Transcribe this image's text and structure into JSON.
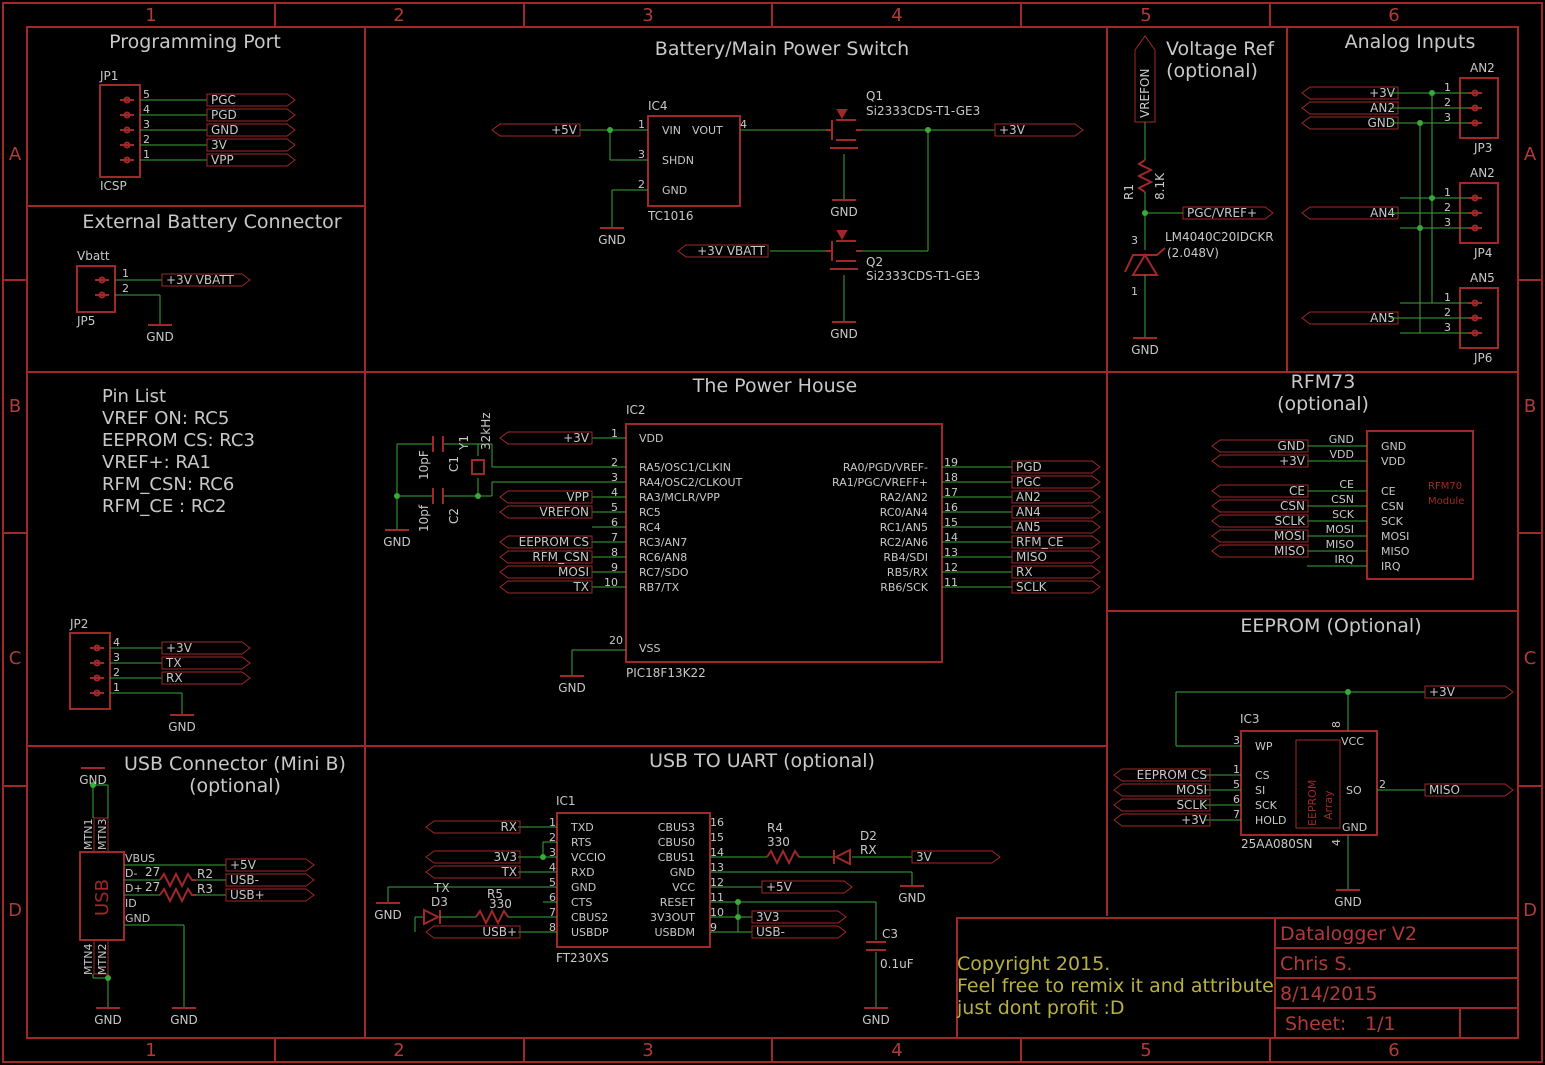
{
  "frame": {
    "columns": [
      "1",
      "2",
      "3",
      "4",
      "5",
      "6"
    ],
    "rows": [
      "A",
      "B",
      "C",
      "D"
    ]
  },
  "sections": {
    "programming_port": "Programming Port",
    "external_battery": "External Battery Connector",
    "battery_switch": "Battery/Main Power Switch",
    "voltage_ref_1": "Voltage Ref",
    "voltage_ref_2": "(optional)",
    "analog_inputs": "Analog Inputs",
    "power_house": "The Power House",
    "rfm73_1": "RFM73",
    "rfm73_2": "(optional)",
    "eeprom": "EEPROM (Optional)",
    "usb_conn_1": "USB Connector (Mini B)",
    "usb_conn_2": "(optional)",
    "usb_uart": "USB TO UART (optional)"
  },
  "pin_list": [
    "Pin List",
    "VREF ON: RC5",
    "EEPROM CS: RC3",
    "VREF+: RA1",
    "RFM_CSN: RC6",
    "RFM_CE : RC2"
  ],
  "jp1": {
    "name": "JP1",
    "value": "ICSP",
    "pins": [
      "5",
      "4",
      "3",
      "2",
      "1"
    ],
    "nets": [
      "PGC",
      "PGD",
      "GND",
      "3V",
      "VPP"
    ]
  },
  "jp5": {
    "name": "Vbatt",
    "ref": "JP5",
    "pins": [
      "1",
      "2"
    ],
    "net": "+3V VBATT",
    "gnd": "GND"
  },
  "jp2": {
    "name": "JP2",
    "pins": [
      "4",
      "3",
      "2",
      "1"
    ],
    "nets": [
      "+3V",
      "TX",
      "RX"
    ],
    "gnd": "GND"
  },
  "ic4": {
    "name": "IC4",
    "value": "TC1016",
    "pins": {
      "vin": "VIN",
      "vout": "VOUT",
      "shdn": "SHDN",
      "gnd": "GND"
    },
    "nums": [
      "1",
      "3",
      "2",
      "4"
    ],
    "net_in": "+5V",
    "gnd": "GND"
  },
  "q1": {
    "name": "Q1",
    "value": "Si2333CDS-T1-GE3",
    "net": "+3V",
    "gnd": "GND"
  },
  "q2": {
    "name": "Q2",
    "value": "Si2333CDS-T1-GE3",
    "net": "+3V VBATT",
    "gnd": "GND"
  },
  "vref": {
    "net": "VREFON",
    "r1": "R1",
    "r1_val": "8.1K",
    "out": "PGC/VREF+",
    "d": "LM4040C20IDCKR",
    "d_val": "(2.048V)",
    "p3": "3",
    "p1": "1",
    "gnd": "GND"
  },
  "analog": {
    "an2": {
      "label": "AN2",
      "ref": "JP3",
      "nets": [
        "+3V",
        "AN2",
        "GND"
      ]
    },
    "an4": {
      "label": "AN4",
      "ref": "JP4",
      "net": "AN4"
    },
    "an5": {
      "label": "AN5",
      "ref": "JP6",
      "net": "AN5"
    },
    "pins": [
      "1",
      "2",
      "3"
    ]
  },
  "ic2": {
    "name": "IC2",
    "value": "PIC18F13K22",
    "left": [
      [
        "1",
        "VDD",
        "+3V"
      ],
      [
        "2",
        "RA5/OSC1/CLKIN",
        ""
      ],
      [
        "3",
        "RA4/OSC2/CLKOUT",
        ""
      ],
      [
        "4",
        "RA3/MCLR/VPP",
        "VPP"
      ],
      [
        "5",
        "RC5",
        "VREFON"
      ],
      [
        "6",
        "RC4",
        ""
      ],
      [
        "7",
        "RC3/AN7",
        "EEPROM CS"
      ],
      [
        "8",
        "RC6/AN8",
        "RFM_CSN"
      ],
      [
        "9",
        "RC7/SDO",
        "MOSI"
      ],
      [
        "10",
        "RB7/TX",
        "TX"
      ]
    ],
    "right": [
      [
        "19",
        "RA0/PGD/VREF-",
        "PGD"
      ],
      [
        "18",
        "RA1/PGC/VREFF+",
        "PGC"
      ],
      [
        "17",
        "RA2/AN2",
        "AN2"
      ],
      [
        "16",
        "RC0/AN4",
        "AN4"
      ],
      [
        "15",
        "RC1/AN5",
        "AN5"
      ],
      [
        "14",
        "RC2/AN6",
        "RFM_CE"
      ],
      [
        "13",
        "RB4/SDI",
        "MISO"
      ],
      [
        "12",
        "RB5/RX",
        "RX"
      ],
      [
        "11",
        "RB6/SCK",
        "SCLK"
      ]
    ],
    "vss": [
      "20",
      "VSS"
    ],
    "gnd": "GND",
    "c1": "C1",
    "c1_val": "10pF",
    "c2": "C2",
    "c2_val": "10pf",
    "y1": "Y1",
    "y1_val": "32kHz"
  },
  "rfm": {
    "left": [
      [
        "GND",
        "GND"
      ],
      [
        "+3V",
        "VDD"
      ],
      [
        "CE",
        "CE"
      ],
      [
        "CSN",
        "CSN"
      ],
      [
        "SCLK",
        "SCK"
      ],
      [
        "MOSI",
        "MOSI"
      ],
      [
        "MISO",
        "MISO"
      ],
      [
        "",
        "IRQ"
      ]
    ],
    "inner": [
      "GND",
      "VDD",
      "CE",
      "CSN",
      "SCK",
      "MOSI",
      "MISO",
      "IRQ"
    ],
    "module_1": "RFM70",
    "module_2": "Module"
  },
  "ic3": {
    "name": "IC3",
    "value": "25AA080SN",
    "net_top": "+3V",
    "left": [
      [
        "3",
        "WP",
        ""
      ],
      [
        "1",
        "CS",
        "EEPROM CS"
      ],
      [
        "5",
        "SI",
        "MOSI"
      ],
      [
        "6",
        "SCK",
        "SCLK"
      ],
      [
        "7",
        "HOLD",
        "+3V"
      ]
    ],
    "vcc": "VCC",
    "so": "SO",
    "so_net": "MISO",
    "so_pin": "2",
    "gnd_lbl": "GND",
    "p8": "8",
    "p4": "4",
    "gnd": "GND",
    "inner_1": "EEPROM",
    "inner_2": "Array"
  },
  "usb": {
    "label": "USB",
    "pins": [
      "VBUS",
      "D-",
      "D+",
      "ID",
      "GND"
    ],
    "mtn": [
      "MTN1",
      "MTN3",
      "MTN4",
      "MTN2"
    ],
    "r2": "R2",
    "r3": "R3",
    "r_val": "27",
    "nets": [
      "+5V",
      "USB-",
      "USB+"
    ],
    "gnd": "GND"
  },
  "ic1": {
    "name": "IC1",
    "value": "FT230XS",
    "left": [
      [
        "1",
        "TXD",
        "RX"
      ],
      [
        "2",
        "RTS",
        ""
      ],
      [
        "3",
        "VCCIO",
        "3V3"
      ],
      [
        "4",
        "RXD",
        "TX"
      ],
      [
        "5",
        "GND",
        ""
      ],
      [
        "6",
        "CTS",
        ""
      ],
      [
        "7",
        "CBUS2",
        ""
      ],
      [
        "8",
        "USBDP",
        "USB+"
      ]
    ],
    "right": [
      [
        "16",
        "CBUS3"
      ],
      [
        "15",
        "CBUS0"
      ],
      [
        "14",
        "CBUS1"
      ],
      [
        "13",
        "GND"
      ],
      [
        "12",
        "VCC"
      ],
      [
        "11",
        "RESET"
      ],
      [
        "10",
        "3V3OUT"
      ],
      [
        "9",
        "USBDM"
      ]
    ],
    "r4": "R4",
    "r4_val": "330",
    "d2": "D2",
    "d2_val": "RX",
    "r5": "R5",
    "r5_val": "330",
    "d3": "D3",
    "d3_val": "TX",
    "net_3v": "3V",
    "net_5v": "+5V",
    "net_3v3": "3V3",
    "net_usbm": "USB-",
    "c3": "C3",
    "c3_val": "0.1uF",
    "gnd": "GND"
  },
  "title_block": {
    "project": "Datalogger V2",
    "author": "Chris S.",
    "date": "8/14/2015",
    "sheet_label": "Sheet:",
    "sheet": "1/1",
    "copyright": [
      "Copyright 2015.",
      "Feel free to remix it and attribute",
      " just dont profit :D"
    ]
  },
  "colors": {
    "parts": "#a02828",
    "wires": "#3aa83a",
    "text": "#c8c8c8",
    "copyright": "#b8b040"
  }
}
